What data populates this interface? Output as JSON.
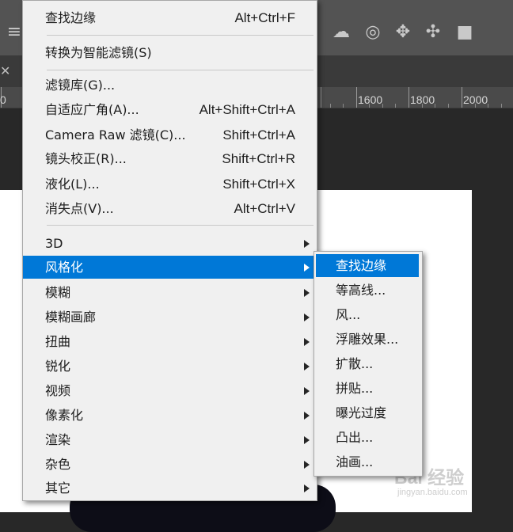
{
  "ruler": {
    "labels": [
      "0",
      "1600",
      "1800",
      "2000"
    ]
  },
  "filter_menu": {
    "items": [
      {
        "label": "查找边缘",
        "shortcut": "Alt+Ctrl+F"
      },
      {
        "label": "转换为智能滤镜(S)",
        "shortcut": ""
      },
      {
        "label": "滤镜库(G)...",
        "shortcut": ""
      },
      {
        "label": "自适应广角(A)...",
        "shortcut": "Alt+Shift+Ctrl+A"
      },
      {
        "label": "Camera Raw 滤镜(C)...",
        "shortcut": "Shift+Ctrl+A"
      },
      {
        "label": "镜头校正(R)...",
        "shortcut": "Shift+Ctrl+R"
      },
      {
        "label": "液化(L)...",
        "shortcut": "Shift+Ctrl+X"
      },
      {
        "label": "消失点(V)...",
        "shortcut": "Alt+Ctrl+V"
      },
      {
        "label": "3D",
        "has_submenu": true
      },
      {
        "label": "风格化",
        "has_submenu": true,
        "highlighted": true
      },
      {
        "label": "模糊",
        "has_submenu": true
      },
      {
        "label": "模糊画廊",
        "has_submenu": true
      },
      {
        "label": "扭曲",
        "has_submenu": true
      },
      {
        "label": "锐化",
        "has_submenu": true
      },
      {
        "label": "视频",
        "has_submenu": true
      },
      {
        "label": "像素化",
        "has_submenu": true
      },
      {
        "label": "渲染",
        "has_submenu": true
      },
      {
        "label": "杂色",
        "has_submenu": true
      },
      {
        "label": "其它",
        "has_submenu": true
      }
    ]
  },
  "stylize_submenu": {
    "items": [
      {
        "label": "查找边缘",
        "highlighted": true
      },
      {
        "label": "等高线..."
      },
      {
        "label": "风..."
      },
      {
        "label": "浮雕效果..."
      },
      {
        "label": "扩散..."
      },
      {
        "label": "拼贴..."
      },
      {
        "label": "曝光过度"
      },
      {
        "label": "凸出..."
      },
      {
        "label": "油画..."
      }
    ]
  },
  "watermark": {
    "main": "Bai 经验",
    "sub": "jingyan.baidu.com"
  },
  "colors": {
    "highlight": "#0078d7",
    "menu_bg": "#f0f0f0",
    "toolbar_bg": "#535353",
    "workspace_bg": "#282828",
    "accent_pink": "#e8335f"
  }
}
